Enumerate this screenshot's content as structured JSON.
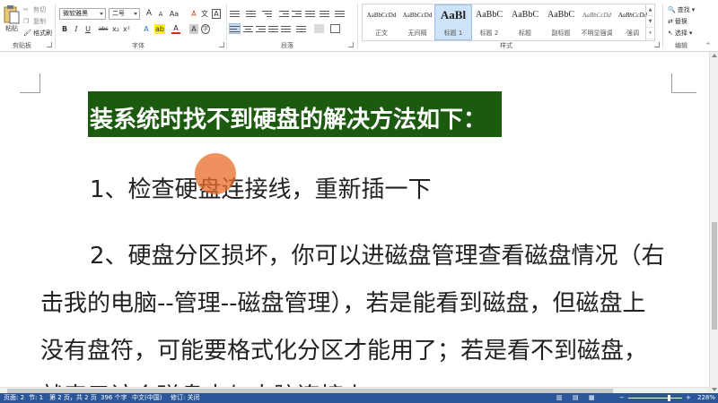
{
  "ribbon": {
    "clipboard": {
      "paste_label": "粘贴",
      "cut_label": "剪切",
      "copy_label": "复制",
      "format_painter_label": "格式刷",
      "group_label": "剪贴板"
    },
    "font": {
      "font_name": "微软雅黑",
      "font_size": "二号",
      "group_label": "字体",
      "bold": "B",
      "italic": "I",
      "underline": "U",
      "strikethrough": "abc",
      "subscript": "x₂",
      "superscript": "x²",
      "grow": "A",
      "shrink": "A",
      "change_case": "Aa",
      "clear_format": "A",
      "phonetic": "文",
      "border": "A",
      "highlight": "ab",
      "font_color": "A",
      "shading": "A",
      "enclose": "字"
    },
    "paragraph": {
      "group_label": "段落"
    },
    "styles": {
      "group_label": "样式",
      "items": [
        {
          "sample": "AaBbCcDd",
          "name": "正文"
        },
        {
          "sample": "AaBbCcDd",
          "name": "无间隔"
        },
        {
          "sample": "AaBl",
          "name": "标题 1"
        },
        {
          "sample": "AaBbC",
          "name": "标题 2"
        },
        {
          "sample": "AaBbC",
          "name": "标题"
        },
        {
          "sample": "AaBbC",
          "name": "副标题"
        },
        {
          "sample": "AaBbCcDd",
          "name": "不明显强调"
        },
        {
          "sample": "AaBbCcDd",
          "name": "强调"
        }
      ]
    },
    "editing": {
      "find_label": "查找",
      "replace_label": "替换",
      "select_label": "选择",
      "group_label": "编辑"
    }
  },
  "document": {
    "heading": "装系统时找不到硬盘的解决方法如下：",
    "lines": [
      "1、检查硬盘连接线，重新插一下",
      "2、硬盘分区损坏，你可以进磁盘管理查看磁盘情况（右",
      "击我的电脑--管理--磁盘管理），若是能看到磁盘，但磁盘上",
      "没有盘符，可能要格式化分区才能用了；若是看不到磁盘，",
      "就表示该个磁盘未与电脑连接上"
    ]
  },
  "status": {
    "page": "页面: 2",
    "section": "节: 1",
    "pages": "第 2 页，共 2 页",
    "words": "396 个字",
    "language": "中文(中国)",
    "track": "修订: 关闭",
    "zoom": "228%"
  },
  "colors": {
    "heading_bg": "#1c5a0f",
    "status_bg": "#2b579a",
    "cursor_highlight": "#e86c28"
  }
}
